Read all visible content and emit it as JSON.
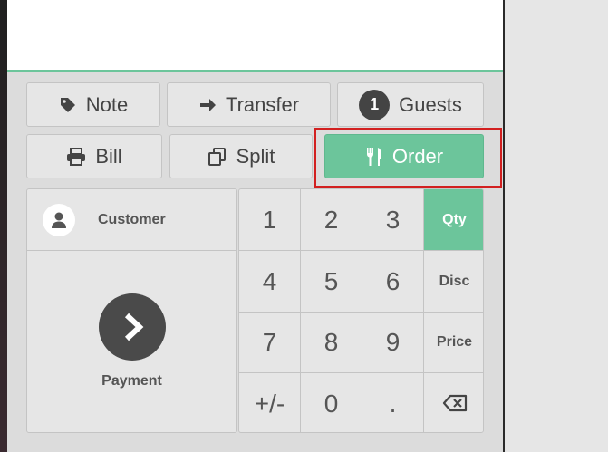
{
  "actions": {
    "note": {
      "label": "Note",
      "icon": "tag-icon"
    },
    "transfer": {
      "label": "Transfer",
      "icon": "arrow-right-icon"
    },
    "guests": {
      "label": "Guests",
      "count": "1"
    },
    "bill": {
      "label": "Bill",
      "icon": "printer-icon"
    },
    "split": {
      "label": "Split",
      "icon": "copy-icon"
    },
    "order": {
      "label": "Order",
      "icon": "utensils-icon",
      "active": true
    }
  },
  "customer": {
    "label": "Customer",
    "icon": "user-icon"
  },
  "payment": {
    "label": "Payment",
    "icon": "chevron-right-icon"
  },
  "numpad": {
    "keys": [
      "1",
      "2",
      "3",
      "4",
      "5",
      "6",
      "7",
      "8",
      "9",
      "+/-",
      "0",
      "."
    ],
    "modes": {
      "qty": "Qty",
      "disc": "Disc",
      "price": "Price"
    },
    "active_mode": "Qty",
    "backspace_icon": "backspace-icon"
  },
  "colors": {
    "accent": "#6cc59b",
    "button_bg": "#e6e6e6",
    "text": "#444444",
    "highlight": "#d22020"
  }
}
